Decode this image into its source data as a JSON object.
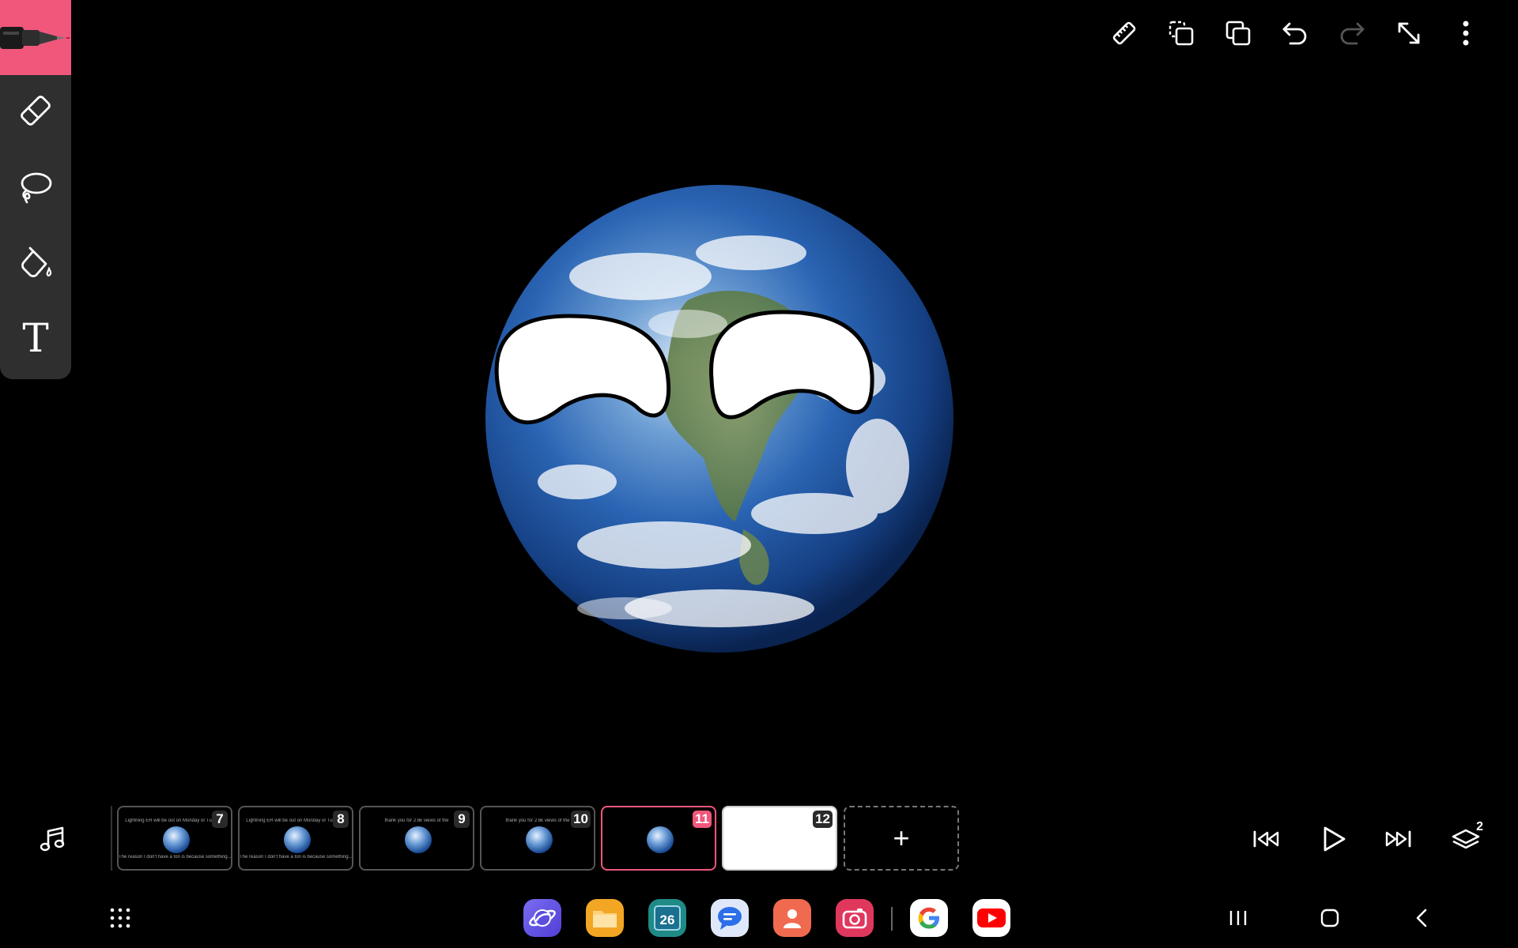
{
  "toolbar": {
    "icons": [
      "back-icon",
      "ruler-icon",
      "copy-frame-icon",
      "duplicate-icon",
      "undo-icon",
      "redo-icon",
      "expand-icon",
      "more-icon"
    ]
  },
  "tools": [
    "pen",
    "eraser",
    "lasso",
    "fill",
    "text"
  ],
  "text_tool_label": "T",
  "frames": [
    {
      "number": "7",
      "line1": "Lightning ER will be out on Monday or Tuesday",
      "line2": "The reason I don't have a ton is because something..."
    },
    {
      "number": "8",
      "line1": "Lightning ER will be out on Monday or Tuesday",
      "line2": "The reason I don't have a ton is because something..."
    },
    {
      "number": "9",
      "line1": "thank you for 2.6k views of the",
      "line2": ""
    },
    {
      "number": "10",
      "line1": "thank you for 2.6k views of the",
      "line2": ""
    },
    {
      "number": "11",
      "line1": "",
      "line2": ""
    },
    {
      "number": "12",
      "line1": "",
      "line2": ""
    }
  ],
  "add_frame_label": "+",
  "playback": {
    "layers_count": "2"
  },
  "dock": {
    "calendar_day": "26",
    "apps": [
      "internet",
      "my-files",
      "calendar",
      "messages",
      "contacts",
      "camera",
      "google",
      "youtube"
    ]
  },
  "colors": {
    "accent": "#f0577b",
    "panel": "#2f2f2f",
    "background": "#000000"
  }
}
